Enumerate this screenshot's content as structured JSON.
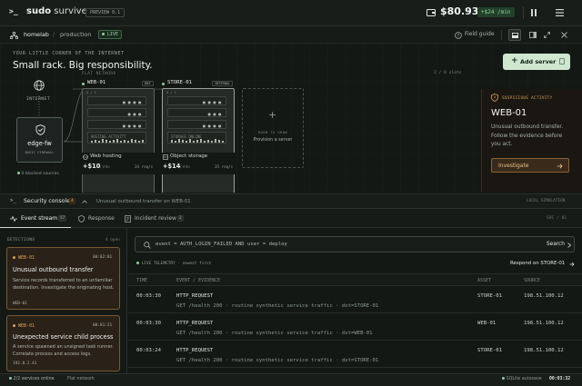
{
  "brand": {
    "name_bold": "sudo",
    "name_light": "survive",
    "badge": "PREVIEW 0.1"
  },
  "topbar": {
    "balance": "$80.93",
    "rate": "+$24 /min"
  },
  "crumbs": {
    "home": "homelab",
    "sep": "/",
    "env": "production",
    "live": "LIVE",
    "field_guide": "Field guide"
  },
  "scene": {
    "eyebrow": "YOUR LITTLE CORNER OF THE INTERNET",
    "headline": "Small rack. Big responsibility.",
    "slots": "2 / 8 slots",
    "add_server": "Add server",
    "internet": "INTERNET",
    "flat_network": "FLAT NETWORK",
    "firewall": {
      "name": "edge-fw",
      "sub": "BASIC FIREWALL",
      "blocked": "0 blocked sources"
    },
    "servers": [
      {
        "name": "WEB-01",
        "tag": "DMZ",
        "role": "Web hosting",
        "earn": "+$10",
        "earn_unit": "/ min",
        "reqs": "34 req/s",
        "index": "0 / 1",
        "activity": "HOSTING ACTIVITY"
      },
      {
        "name": "STORE-01",
        "tag": "INTERNAL",
        "role": "Object storage",
        "earn": "+$14",
        "earn_unit": "/ min",
        "reqs": "35 req/s",
        "index": "0 / 1",
        "activity": "STORAGE ONLINE"
      }
    ],
    "empty_slot": {
      "title": "ROOM TO GROW",
      "sub": "Provision a server"
    }
  },
  "alert": {
    "label": "SUSPICIOUS ACTIVITY",
    "host": "WEB-01",
    "message": "Unusual outbound transfer. Follow the evidence before you act.",
    "button": "Investigate"
  },
  "console": {
    "title": "Security console",
    "count": "4",
    "summary": "Unusual outbound transfer on WEB-01",
    "mode": "LOCAL SIMULATION"
  },
  "tabs": [
    {
      "label": "Event stream",
      "count": "57"
    },
    {
      "label": "Response"
    },
    {
      "label": "Incident review",
      "count": "2"
    }
  ],
  "soc": "SOC / 01",
  "detections": {
    "header": "DETECTIONS",
    "open": "4 open",
    "items": [
      {
        "host": "WEB-01",
        "time": "00:02:01",
        "title": "Unusual outbound transfer",
        "body": "Service records transferred to an unfamiliar destination. Investigate the originating host.",
        "foot": "WEB-01"
      },
      {
        "host": "WEB-01",
        "time": "00:01:21",
        "title": "Unexpected service child process",
        "body": "A service spawned an unsigned task runner. Correlate process and access logs.",
        "foot": "192.0.2.41"
      }
    ]
  },
  "search": {
    "query": "event = AUTH_LOGIN_FAILED AND user = deploy",
    "button": "Search"
  },
  "telemetry": {
    "label": "LIVE TELEMETRY · newest first",
    "respond": "Respond on STORE-01"
  },
  "columns": {
    "time": "TIME",
    "event": "EVENT / EVIDENCE",
    "asset": "ASSET",
    "source": "SOURCE"
  },
  "events": [
    {
      "time": "00:03:30",
      "event": "HTTP_REQUEST",
      "detail": "GET /health 200 · routine synthetic service traffic · dst=STORE-01",
      "asset": "STORE-01",
      "source": "198.51.100.12"
    },
    {
      "time": "00:03:30",
      "event": "HTTP_REQUEST",
      "detail": "GET /health 200 · routine synthetic service traffic · dst=WEB-01",
      "asset": "WEB-01",
      "source": "198.51.100.12"
    },
    {
      "time": "00:03:24",
      "event": "HTTP_REQUEST",
      "detail": "GET /health 200 · routine synthetic service traffic · dst=STORE-01",
      "asset": "STORE-01",
      "source": "198.51.100.12"
    }
  ],
  "statusbar": {
    "services": "2/2 services online",
    "network": "Flat network",
    "save": "SQLite autosave",
    "clock": "00:03:32"
  },
  "colors": {
    "accent_green": "#8fd19a",
    "alert_orange": "#e0a458",
    "bg": "#131815"
  },
  "icons": [
    "wallet-icon",
    "pause-icon",
    "menu-icon",
    "tree-icon",
    "book-icon",
    "layout-icon",
    "globe-icon",
    "shield-icon",
    "terminal-icon",
    "search-icon",
    "arrow-right-icon"
  ]
}
